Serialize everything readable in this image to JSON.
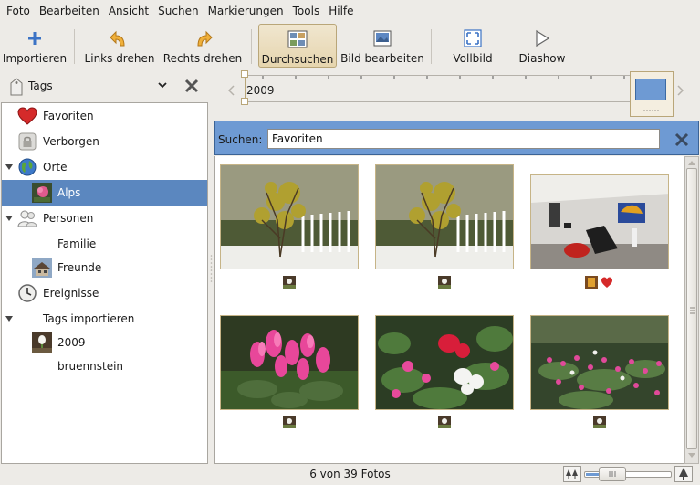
{
  "menubar": {
    "items": [
      {
        "label": "Foto",
        "mnemonic": "F"
      },
      {
        "label": "Bearbeiten",
        "mnemonic": "B"
      },
      {
        "label": "Ansicht",
        "mnemonic": "A"
      },
      {
        "label": "Suchen",
        "mnemonic": "S"
      },
      {
        "label": "Markierungen",
        "mnemonic": "M"
      },
      {
        "label": "Tools",
        "mnemonic": "T"
      },
      {
        "label": "Hilfe",
        "mnemonic": "H"
      }
    ]
  },
  "toolbar": {
    "import_label": "Importieren",
    "rotate_left_label": "Links drehen",
    "rotate_right_label": "Rechts drehen",
    "browse_label": "Durchsuchen",
    "edit_label": "Bild bearbeiten",
    "fullscreen_label": "Vollbild",
    "slideshow_label": "Diashow"
  },
  "sidebar": {
    "header_label": "Tags",
    "items": [
      {
        "label": "Favoriten",
        "icon": "heart-icon"
      },
      {
        "label": "Verborgen",
        "icon": "lock-icon"
      },
      {
        "label": "Orte",
        "icon": "globe-icon",
        "expanded": true
      },
      {
        "label": "Alps",
        "icon": "flower-thumb-icon",
        "selected": true
      },
      {
        "label": "Personen",
        "icon": "people-icon",
        "expanded": true
      },
      {
        "label": "Familie",
        "icon": ""
      },
      {
        "label": "Freunde",
        "icon": "house-thumb-icon"
      },
      {
        "label": "Ereignisse",
        "icon": "clock-icon"
      },
      {
        "label": "Tags importieren",
        "icon": "",
        "expanded": true
      },
      {
        "label": "2009",
        "icon": "snowdrop-thumb-icon"
      },
      {
        "label": "bruennstein",
        "icon": ""
      }
    ]
  },
  "timeline": {
    "year": "2009"
  },
  "search": {
    "label": "Suchen:",
    "value": "Favoriten"
  },
  "photos": [
    {
      "name": "snow-bush-photo-1",
      "tags": [
        "flower-tag"
      ]
    },
    {
      "name": "snow-bush-photo-2",
      "tags": [
        "flower-tag"
      ]
    },
    {
      "name": "gallery-interior-photo",
      "tags": [
        "gallery-tag",
        "favorite-heart"
      ]
    },
    {
      "name": "pink-cyclamen-photo",
      "tags": [
        "flower-tag"
      ]
    },
    {
      "name": "red-white-cyclamen-photo",
      "tags": [
        "flower-tag"
      ]
    },
    {
      "name": "garden-cyclamen-photo",
      "tags": [
        "flower-tag"
      ]
    }
  ],
  "status": {
    "text": "6 von 39 Fotos",
    "zoom_level": 0.25
  },
  "colors": {
    "accent": "#5b87bf",
    "search_bg": "#6e9ad3",
    "heart": "#d52a2a"
  }
}
